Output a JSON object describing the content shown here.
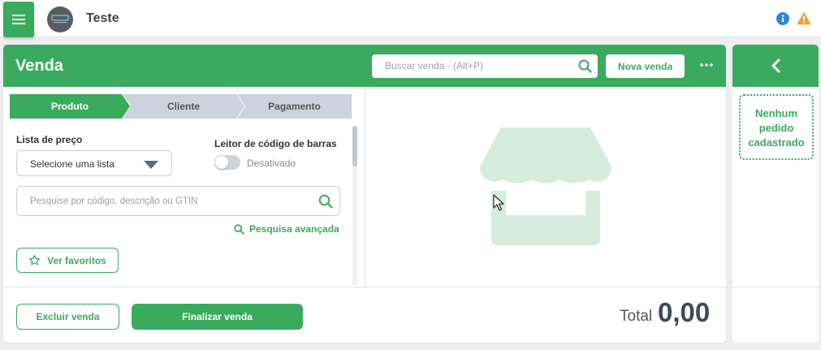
{
  "topbar": {
    "company_name": "Teste"
  },
  "sale": {
    "title": "Venda",
    "search_placeholder": "Buscar venda - (Alt+P)",
    "new_sale_label": "Nova venda",
    "steps": [
      {
        "label": "Produto",
        "active": true
      },
      {
        "label": "Cliente",
        "active": false
      },
      {
        "label": "Pagamento",
        "active": false
      }
    ],
    "price_list": {
      "label": "Lista de preço",
      "value": "Selecione uma lista"
    },
    "barcode_reader": {
      "label": "Leitor de código de barras",
      "status": "Desativado"
    },
    "product_search_placeholder": "Pesquise por código, descrição ou GTIN",
    "advanced_search_label": "Pesquisa avançada",
    "favorites_label": "Ver favoritos",
    "delete_label": "Excluir venda",
    "finish_label": "Finalizar venda",
    "total_label": "Total",
    "total_value": "0,00"
  },
  "orders_panel": {
    "empty_text": "Nenhum pedido cadastrado"
  },
  "colors": {
    "accent": "#3aab5e",
    "step_inactive": "#ccd3dc",
    "illustration": "#d5ecdf",
    "info": "#2f86d6",
    "warning": "#f0a22e"
  },
  "icons": {
    "menu": "hamburger-icon",
    "info": "info-icon",
    "warning": "warning-icon",
    "search": "search-icon",
    "more": "more-horizontal-icon",
    "dropdown": "caret-down-icon",
    "star": "star-icon",
    "back": "chevron-left-icon",
    "illustration": "store-icon"
  }
}
